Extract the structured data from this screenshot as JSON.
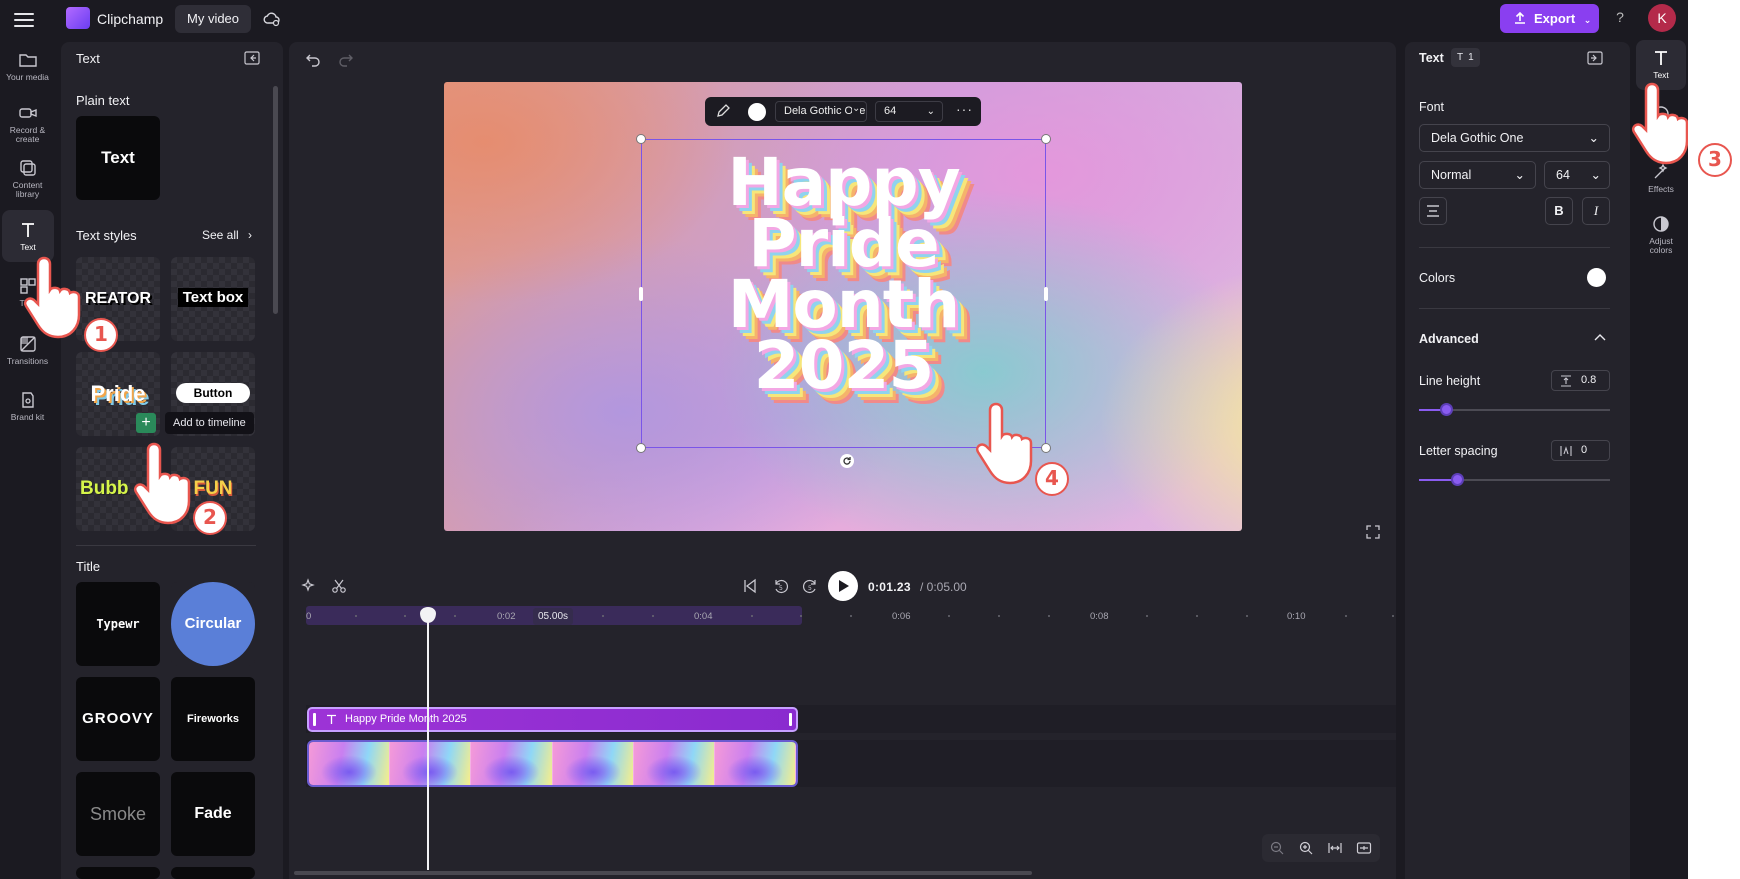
{
  "topbar": {
    "app_name": "Clipchamp",
    "project_name": "My video",
    "export_label": "Export",
    "help_label": "?",
    "avatar_initial": "K"
  },
  "left_nav": {
    "items": [
      {
        "label": "Your media",
        "icon": "folder-icon"
      },
      {
        "label": "Record &\ncreate",
        "icon": "camera-icon"
      },
      {
        "label": "Content\nlibrary",
        "icon": "library-icon"
      },
      {
        "label": "Text",
        "icon": "text-icon",
        "active": true
      },
      {
        "label": "Tem",
        "icon": "templates-icon"
      },
      {
        "label": "Transitions",
        "icon": "transitions-icon"
      },
      {
        "label": "Brand kit",
        "icon": "brand-kit-icon"
      }
    ]
  },
  "text_panel": {
    "title": "Text",
    "plain_text_heading": "Plain text",
    "plain_text_tile": "Text",
    "text_styles_heading": "Text styles",
    "see_all": "See all",
    "style_tiles": [
      "REATOR",
      "Text box",
      "Pride",
      "Button",
      "Bubb",
      "FUN"
    ],
    "tooltip": "Add to timeline",
    "title_heading": "Title",
    "title_tiles": [
      "Typewr",
      "Circular",
      "GROOVY",
      "Fireworks",
      "Smoke",
      "Fade"
    ]
  },
  "stage": {
    "toolbar_font": "Dela Gothic One",
    "toolbar_size": "64",
    "canvas_text_lines": [
      "Happy",
      "Pride",
      "Month",
      "2025"
    ]
  },
  "timeline": {
    "current_time": "0:01.23",
    "duration": "/ 0:05.00",
    "tooltip_time": "05.00s",
    "tick_labels": [
      "0",
      "0:02",
      "0:04",
      "0:06",
      "0:08",
      "0:10"
    ],
    "text_clip_label": "Happy Pride Month 2025"
  },
  "properties": {
    "title": "Text",
    "layer_count": "1",
    "font_heading": "Font",
    "font_value": "Dela Gothic One",
    "weight_value": "Normal",
    "size_value": "64",
    "bold_label": "B",
    "italic_label": "I",
    "colors_heading": "Colors",
    "text_color": "#ffffff",
    "advanced_heading": "Advanced",
    "line_height_label": "Line height",
    "line_height_value": "0.8",
    "line_height_slider": 0.14,
    "letter_spacing_label": "Letter spacing",
    "letter_spacing_value": "0",
    "letter_spacing_slider": 0.2
  },
  "right_rail": {
    "items": [
      {
        "label": "Text",
        "icon": "text-icon",
        "active": true
      },
      {
        "label": "",
        "icon": "filters-icon"
      },
      {
        "label": "Effects",
        "icon": "effects-icon"
      },
      {
        "label": "Adjust\ncolors",
        "icon": "adjust-colors-icon"
      }
    ]
  },
  "steps": [
    "1",
    "2",
    "3",
    "4"
  ],
  "colors": {
    "accent": "#8a3ff0",
    "step_badge": "#e8564f",
    "app_background": "#1b1a21"
  }
}
